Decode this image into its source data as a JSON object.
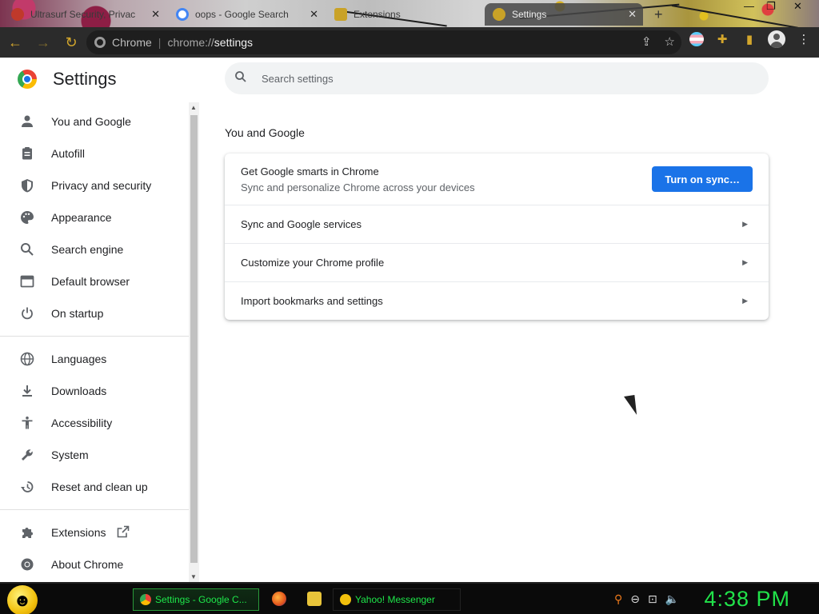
{
  "browser": {
    "tabs": [
      {
        "title": "Ultrasurf Security, Privac",
        "active": false
      },
      {
        "title": "oops - Google Search",
        "active": false
      },
      {
        "title": "Extensions",
        "active": false
      },
      {
        "title": "Settings",
        "active": true
      }
    ],
    "new_tab_icon": "+",
    "window_controls": {
      "minimize": "—",
      "maximize": "❐",
      "close": "✕"
    },
    "omnibox": {
      "site_label": "Chrome",
      "url_prefix": "chrome://",
      "url_path": "settings"
    }
  },
  "settings": {
    "title": "Settings",
    "search_placeholder": "Search settings",
    "nav_main": [
      {
        "label": "You and Google",
        "icon": "person-icon"
      },
      {
        "label": "Autofill",
        "icon": "clipboard-icon"
      },
      {
        "label": "Privacy and security",
        "icon": "shield-icon"
      },
      {
        "label": "Appearance",
        "icon": "palette-icon"
      },
      {
        "label": "Search engine",
        "icon": "search-icon"
      },
      {
        "label": "Default browser",
        "icon": "browser-icon"
      },
      {
        "label": "On startup",
        "icon": "power-icon"
      }
    ],
    "nav_advanced": [
      {
        "label": "Languages",
        "icon": "globe-icon"
      },
      {
        "label": "Downloads",
        "icon": "download-icon"
      },
      {
        "label": "Accessibility",
        "icon": "accessibility-icon"
      },
      {
        "label": "System",
        "icon": "wrench-icon"
      },
      {
        "label": "Reset and clean up",
        "icon": "history-icon"
      }
    ],
    "nav_bottom": [
      {
        "label": "Extensions",
        "icon": "puzzle-icon"
      },
      {
        "label": "About Chrome",
        "icon": "chrome-icon"
      }
    ],
    "section_title": "You and Google",
    "sync_card": {
      "heading": "Get Google smarts in Chrome",
      "subtext": "Sync and personalize Chrome across your devices",
      "button": "Turn on sync…"
    },
    "rows": [
      "Sync and Google services",
      "Customize your Chrome profile",
      "Import bookmarks and settings"
    ]
  },
  "taskbar": {
    "tasks": [
      {
        "label": "Settings - Google C...",
        "active": true
      },
      {
        "label": "Yahoo! Messenger",
        "active": false
      }
    ],
    "clock": "4:38 PM"
  },
  "colors": {
    "accent_blue": "#1a73e8",
    "toolbar_icon": "#d4a72c",
    "taskbar_green": "#1ee84a"
  }
}
